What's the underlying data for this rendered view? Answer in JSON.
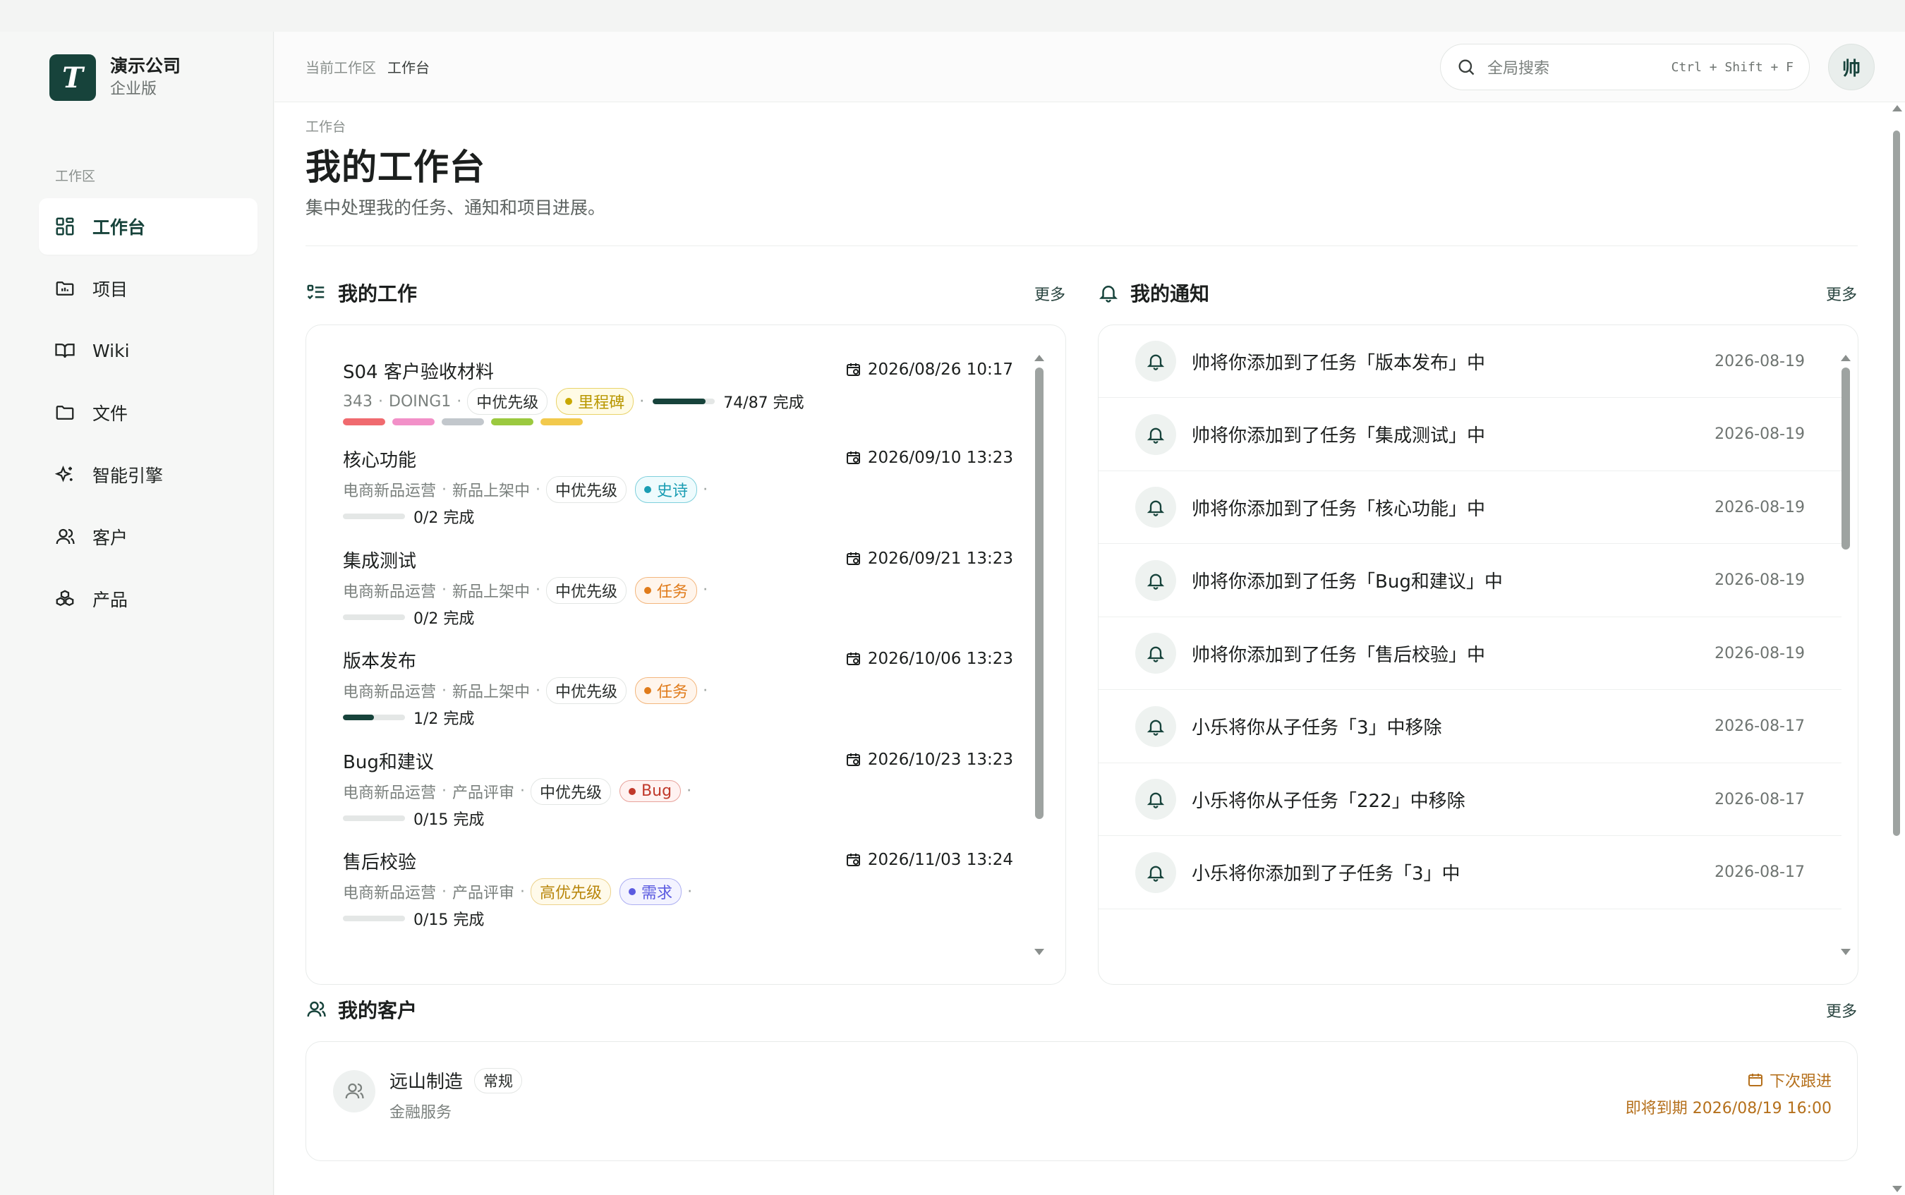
{
  "brand": {
    "name": "演示公司",
    "edition": "企业版",
    "logo_letter": "T"
  },
  "sidebar": {
    "section_label": "工作区",
    "items": [
      {
        "label": "工作台",
        "icon": "dashboard-icon",
        "active": true
      },
      {
        "label": "项目",
        "icon": "project-folder-icon"
      },
      {
        "label": "Wiki",
        "icon": "book-icon"
      },
      {
        "label": "文件",
        "icon": "folder-icon"
      },
      {
        "label": "智能引擎",
        "icon": "sparkle-icon"
      },
      {
        "label": "客户",
        "icon": "user-icon"
      },
      {
        "label": "产品",
        "icon": "cubes-icon"
      }
    ]
  },
  "header": {
    "crumb_workspace": "当前工作区",
    "crumb_current": "工作台",
    "search_placeholder": "全局搜索",
    "search_shortcut": "Ctrl + Shift + F",
    "avatar": "帅"
  },
  "page": {
    "crumb": "工作台",
    "title": "我的工作台",
    "description": "集中处理我的任务、通知和项目进展。"
  },
  "work": {
    "title": "我的工作",
    "more": "更多",
    "first": {
      "title": "S04 客户验收材料",
      "date": "2026/08/26 10:17",
      "id": "343",
      "status": "DOING1",
      "priority": "中优先级",
      "type": "里程碑",
      "progress": 0.85,
      "progress_text": "74/87 完成",
      "colors": [
        "#f06a6f",
        "#f290c8",
        "#c2c7cc",
        "#9bc93f",
        "#f2c94c"
      ]
    },
    "tasks": [
      {
        "title": "核心功能",
        "date": "2026/09/10 13:23",
        "project": "电商新品运营",
        "stage": "新品上架中",
        "priority": "中优先级",
        "type": "史诗",
        "tag": "epic",
        "progress": 0,
        "progress_text": "0/2 完成"
      },
      {
        "title": "集成测试",
        "date": "2026/09/21 13:23",
        "project": "电商新品运营",
        "stage": "新品上架中",
        "priority": "中优先级",
        "type": "任务",
        "tag": "task2",
        "progress": 0,
        "progress_text": "0/2 完成"
      },
      {
        "title": "版本发布",
        "date": "2026/10/06 13:23",
        "project": "电商新品运营",
        "stage": "新品上架中",
        "priority": "中优先级",
        "type": "任务",
        "tag": "task2",
        "progress": 0.5,
        "progress_text": "1/2 完成"
      },
      {
        "title": "Bug和建议",
        "date": "2026/10/23 13:23",
        "project": "电商新品运营",
        "stage": "产品评审",
        "priority": "中优先级",
        "type": "Bug",
        "tag": "bug",
        "progress": 0,
        "progress_text": "0/15 完成"
      },
      {
        "title": "售后校验",
        "date": "2026/11/03 13:24",
        "project": "电商新品运营",
        "stage": "产品评审",
        "priority": "高优先级",
        "priority_style": "high",
        "type": "需求",
        "tag": "req",
        "progress": 0,
        "progress_text": "0/15 完成"
      }
    ]
  },
  "notifications": {
    "title": "我的通知",
    "more": "更多",
    "items": [
      {
        "text": "帅将你添加到了任务「版本发布」中",
        "date": "2026-08-19"
      },
      {
        "text": "帅将你添加到了任务「集成测试」中",
        "date": "2026-08-19"
      },
      {
        "text": "帅将你添加到了任务「核心功能」中",
        "date": "2026-08-19"
      },
      {
        "text": "帅将你添加到了任务「Bug和建议」中",
        "date": "2026-08-19"
      },
      {
        "text": "帅将你添加到了任务「售后校验」中",
        "date": "2026-08-19"
      },
      {
        "text": "小乐将你从子任务「3」中移除",
        "date": "2026-08-17"
      },
      {
        "text": "小乐将你从子任务「222」中移除",
        "date": "2026-08-17"
      },
      {
        "text": "小乐将你添加到了子任务「3」中",
        "date": "2026-08-17"
      }
    ]
  },
  "customers": {
    "title": "我的客户",
    "more": "更多",
    "items": [
      {
        "name": "远山制造",
        "level": "常规",
        "industry": "金融服务",
        "followup_label": "下次跟进",
        "followup_due": "即将到期 2026/08/19 16:00"
      }
    ]
  },
  "colors": {
    "brand": "#17433b",
    "followup": "#b5701c"
  }
}
